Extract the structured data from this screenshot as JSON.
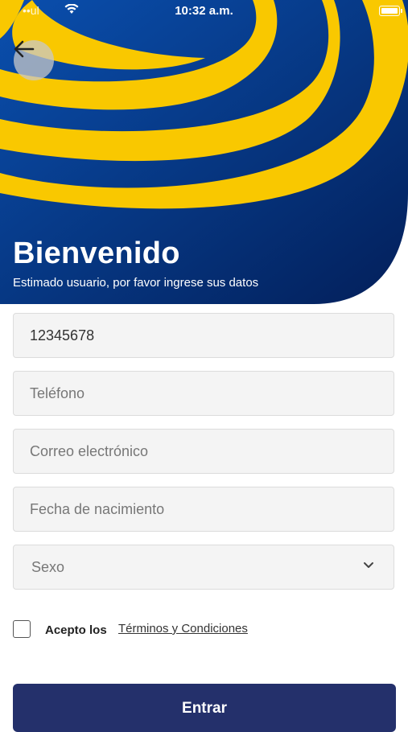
{
  "status_bar": {
    "carrier": "••ul",
    "time": "10:32 a.m."
  },
  "header": {
    "title": "Bienvenido",
    "subtitle": "Estimado usuario, por favor ingrese sus datos"
  },
  "form": {
    "document": {
      "value": "12345678",
      "placeholder": ""
    },
    "phone": {
      "placeholder": "Teléfono"
    },
    "email": {
      "placeholder": "Correo electrónico"
    },
    "birthdate": {
      "placeholder": "Fecha de nacimiento"
    },
    "sex": {
      "selected": "Sexo"
    },
    "accept_label": "Acepto los",
    "terms_link": "Términos y Condiciones",
    "submit_label": "Entrar"
  },
  "icons": {
    "back": "arrow-left-icon",
    "select": "chevron-down-icon",
    "wifi": "wifi-icon",
    "battery": "battery-icon"
  },
  "colors": {
    "brand_blue": "#0a3f96",
    "brand_yellow": "#f9c800",
    "button": "#24306b"
  }
}
